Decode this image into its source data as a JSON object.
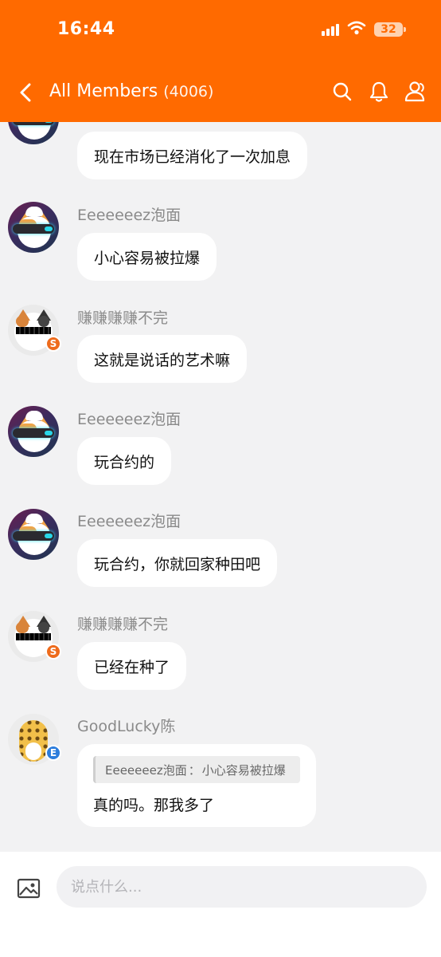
{
  "status": {
    "time": "16:44",
    "battery": "32"
  },
  "header": {
    "title": "All Members",
    "count": "(4006)"
  },
  "messages": [
    {
      "name": "",
      "text": "现在市场已经消化了一次加息"
    },
    {
      "name": "Eeeeeeez泡面",
      "text": "小心容易被拉爆"
    },
    {
      "name": "赚赚赚赚不完",
      "text": "这就是说话的艺术嘛",
      "badge": "S"
    },
    {
      "name": "Eeeeeeez泡面",
      "text": "玩合约的"
    },
    {
      "name": "Eeeeeeez泡面",
      "text": "玩合约，你就回家种田吧"
    },
    {
      "name": "赚赚赚赚不完",
      "text": "已经在种了",
      "badge": "S"
    },
    {
      "name": "GoodLucky陈",
      "badge": "E",
      "quote_author": "Eeeeeeez泡面",
      "quote_sep": "：",
      "quote_text": "小心容易被拉爆",
      "text": "真的吗。那我多了"
    }
  ],
  "input": {
    "placeholder": "说点什么..."
  },
  "colors": {
    "brand": "#ff6a00",
    "background": "#f2f2f3",
    "bubble": "#ffffff",
    "name_text": "#8a8a8a"
  },
  "icons": [
    "back-arrow-icon",
    "search-icon",
    "bell-icon",
    "members-icon",
    "image-icon"
  ]
}
